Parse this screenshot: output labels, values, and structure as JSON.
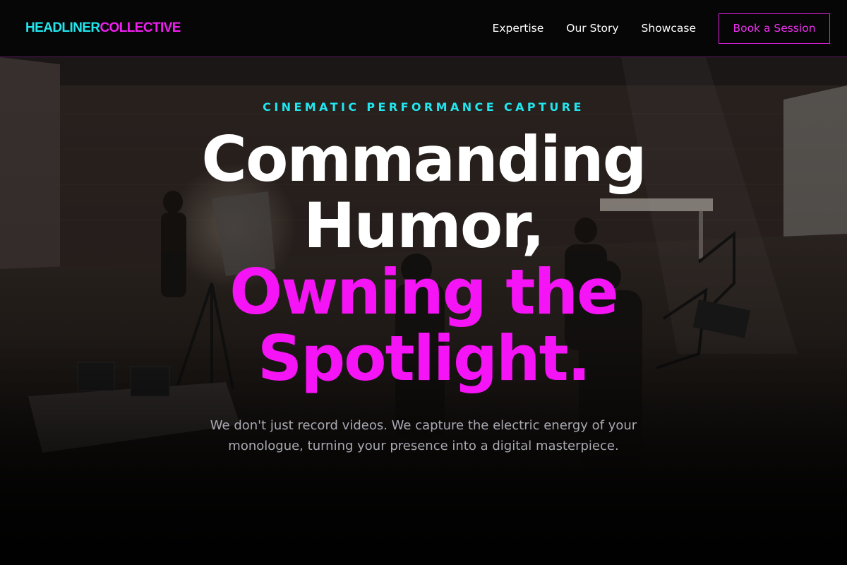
{
  "header": {
    "logo_part1": "HEADLINER",
    "logo_part2": "COLLECTIVE",
    "nav": {
      "expertise": "Expertise",
      "story": "Our Story",
      "showcase": "Showcase"
    },
    "cta_label": "Book a Session"
  },
  "hero": {
    "eyebrow": "CINEMATIC PERFORMANCE CAPTURE",
    "headline_line1": "Commanding",
    "headline_line2": "Humor,",
    "headline_line3": "Owning the",
    "headline_line4": "Spotlight.",
    "subtext": "We don't just record videos. We capture the electric energy of your monologue, turning your presence into a digital masterpiece."
  },
  "colors": {
    "cyan_accent": "#22e6ee",
    "magenta_accent": "#f514f5",
    "background": "#050505"
  }
}
